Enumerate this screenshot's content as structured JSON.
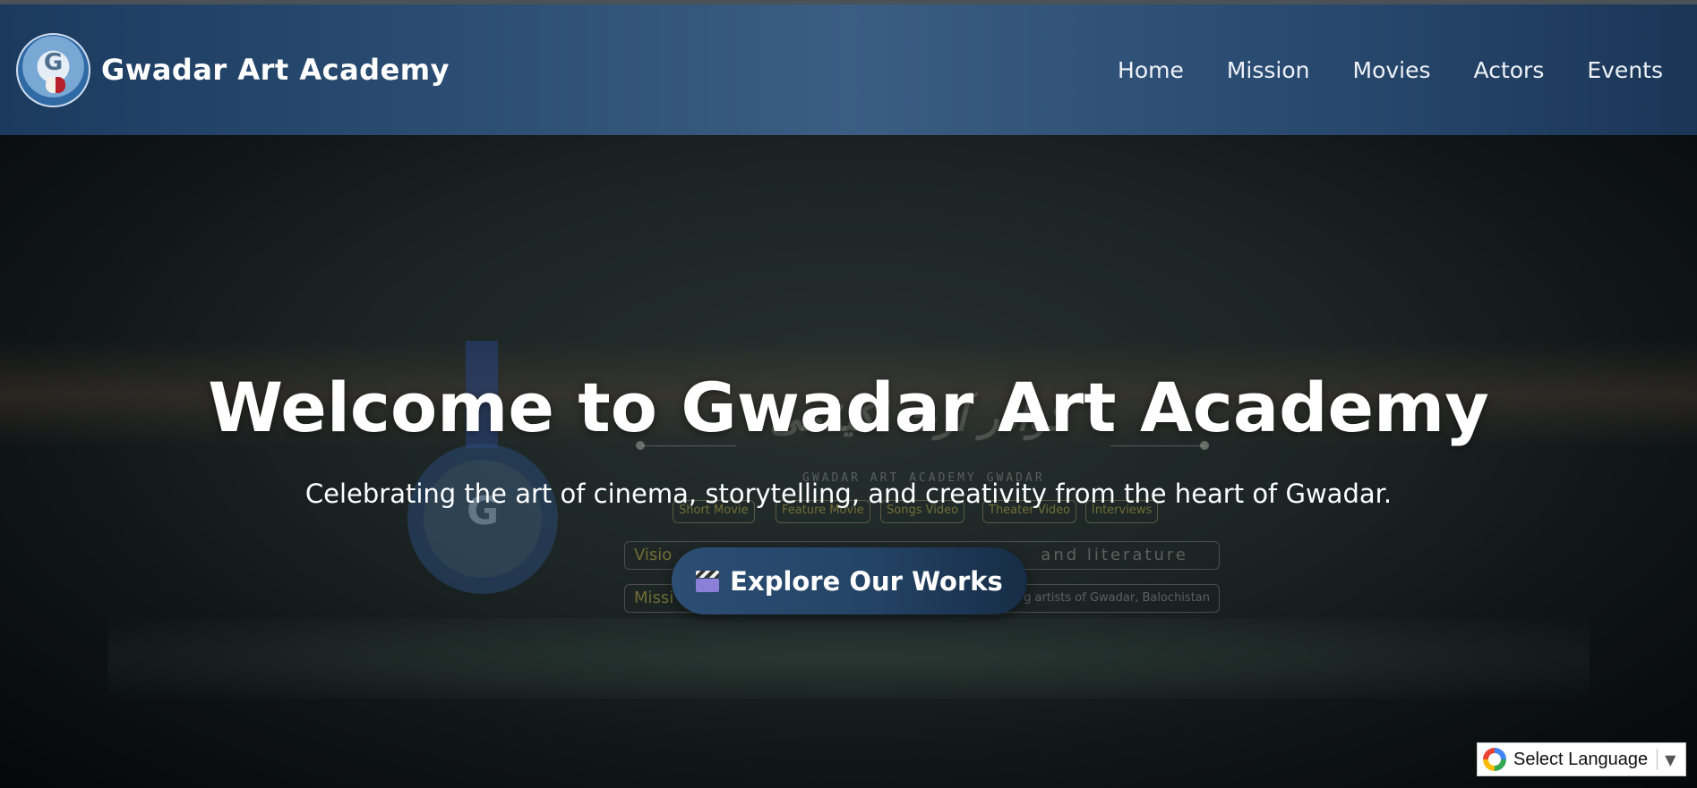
{
  "header": {
    "brand_name": "Gwadar Art Academy",
    "nav": [
      "Home",
      "Mission",
      "Movies",
      "Actors",
      "Events"
    ]
  },
  "hero": {
    "title": "Welcome to Gwadar Art Academy",
    "subtitle": "Celebrating the art of cinema, storytelling, and creativity from the heart of Gwadar.",
    "cta_label": "Explore Our Works",
    "cta_icon": "clapperboard-icon"
  },
  "background_poster": {
    "subtitle": "GWADAR ART ACADEMY GWADAR",
    "categories": [
      "Short Movie",
      "Feature Movie",
      "Songs Video",
      "Theater Video",
      "Interviews"
    ],
    "vision_label": "Visio",
    "vision_text": "and literature",
    "mission_label": "Missi",
    "mission_text": "g artists of Gwadar, Balochistan"
  },
  "translate_widget": {
    "label": "Select Language",
    "arrow": "▼"
  },
  "colors": {
    "nav_bg": "#2a4c72",
    "cta_bg": "#244466",
    "hero_title": "#ffffff"
  }
}
